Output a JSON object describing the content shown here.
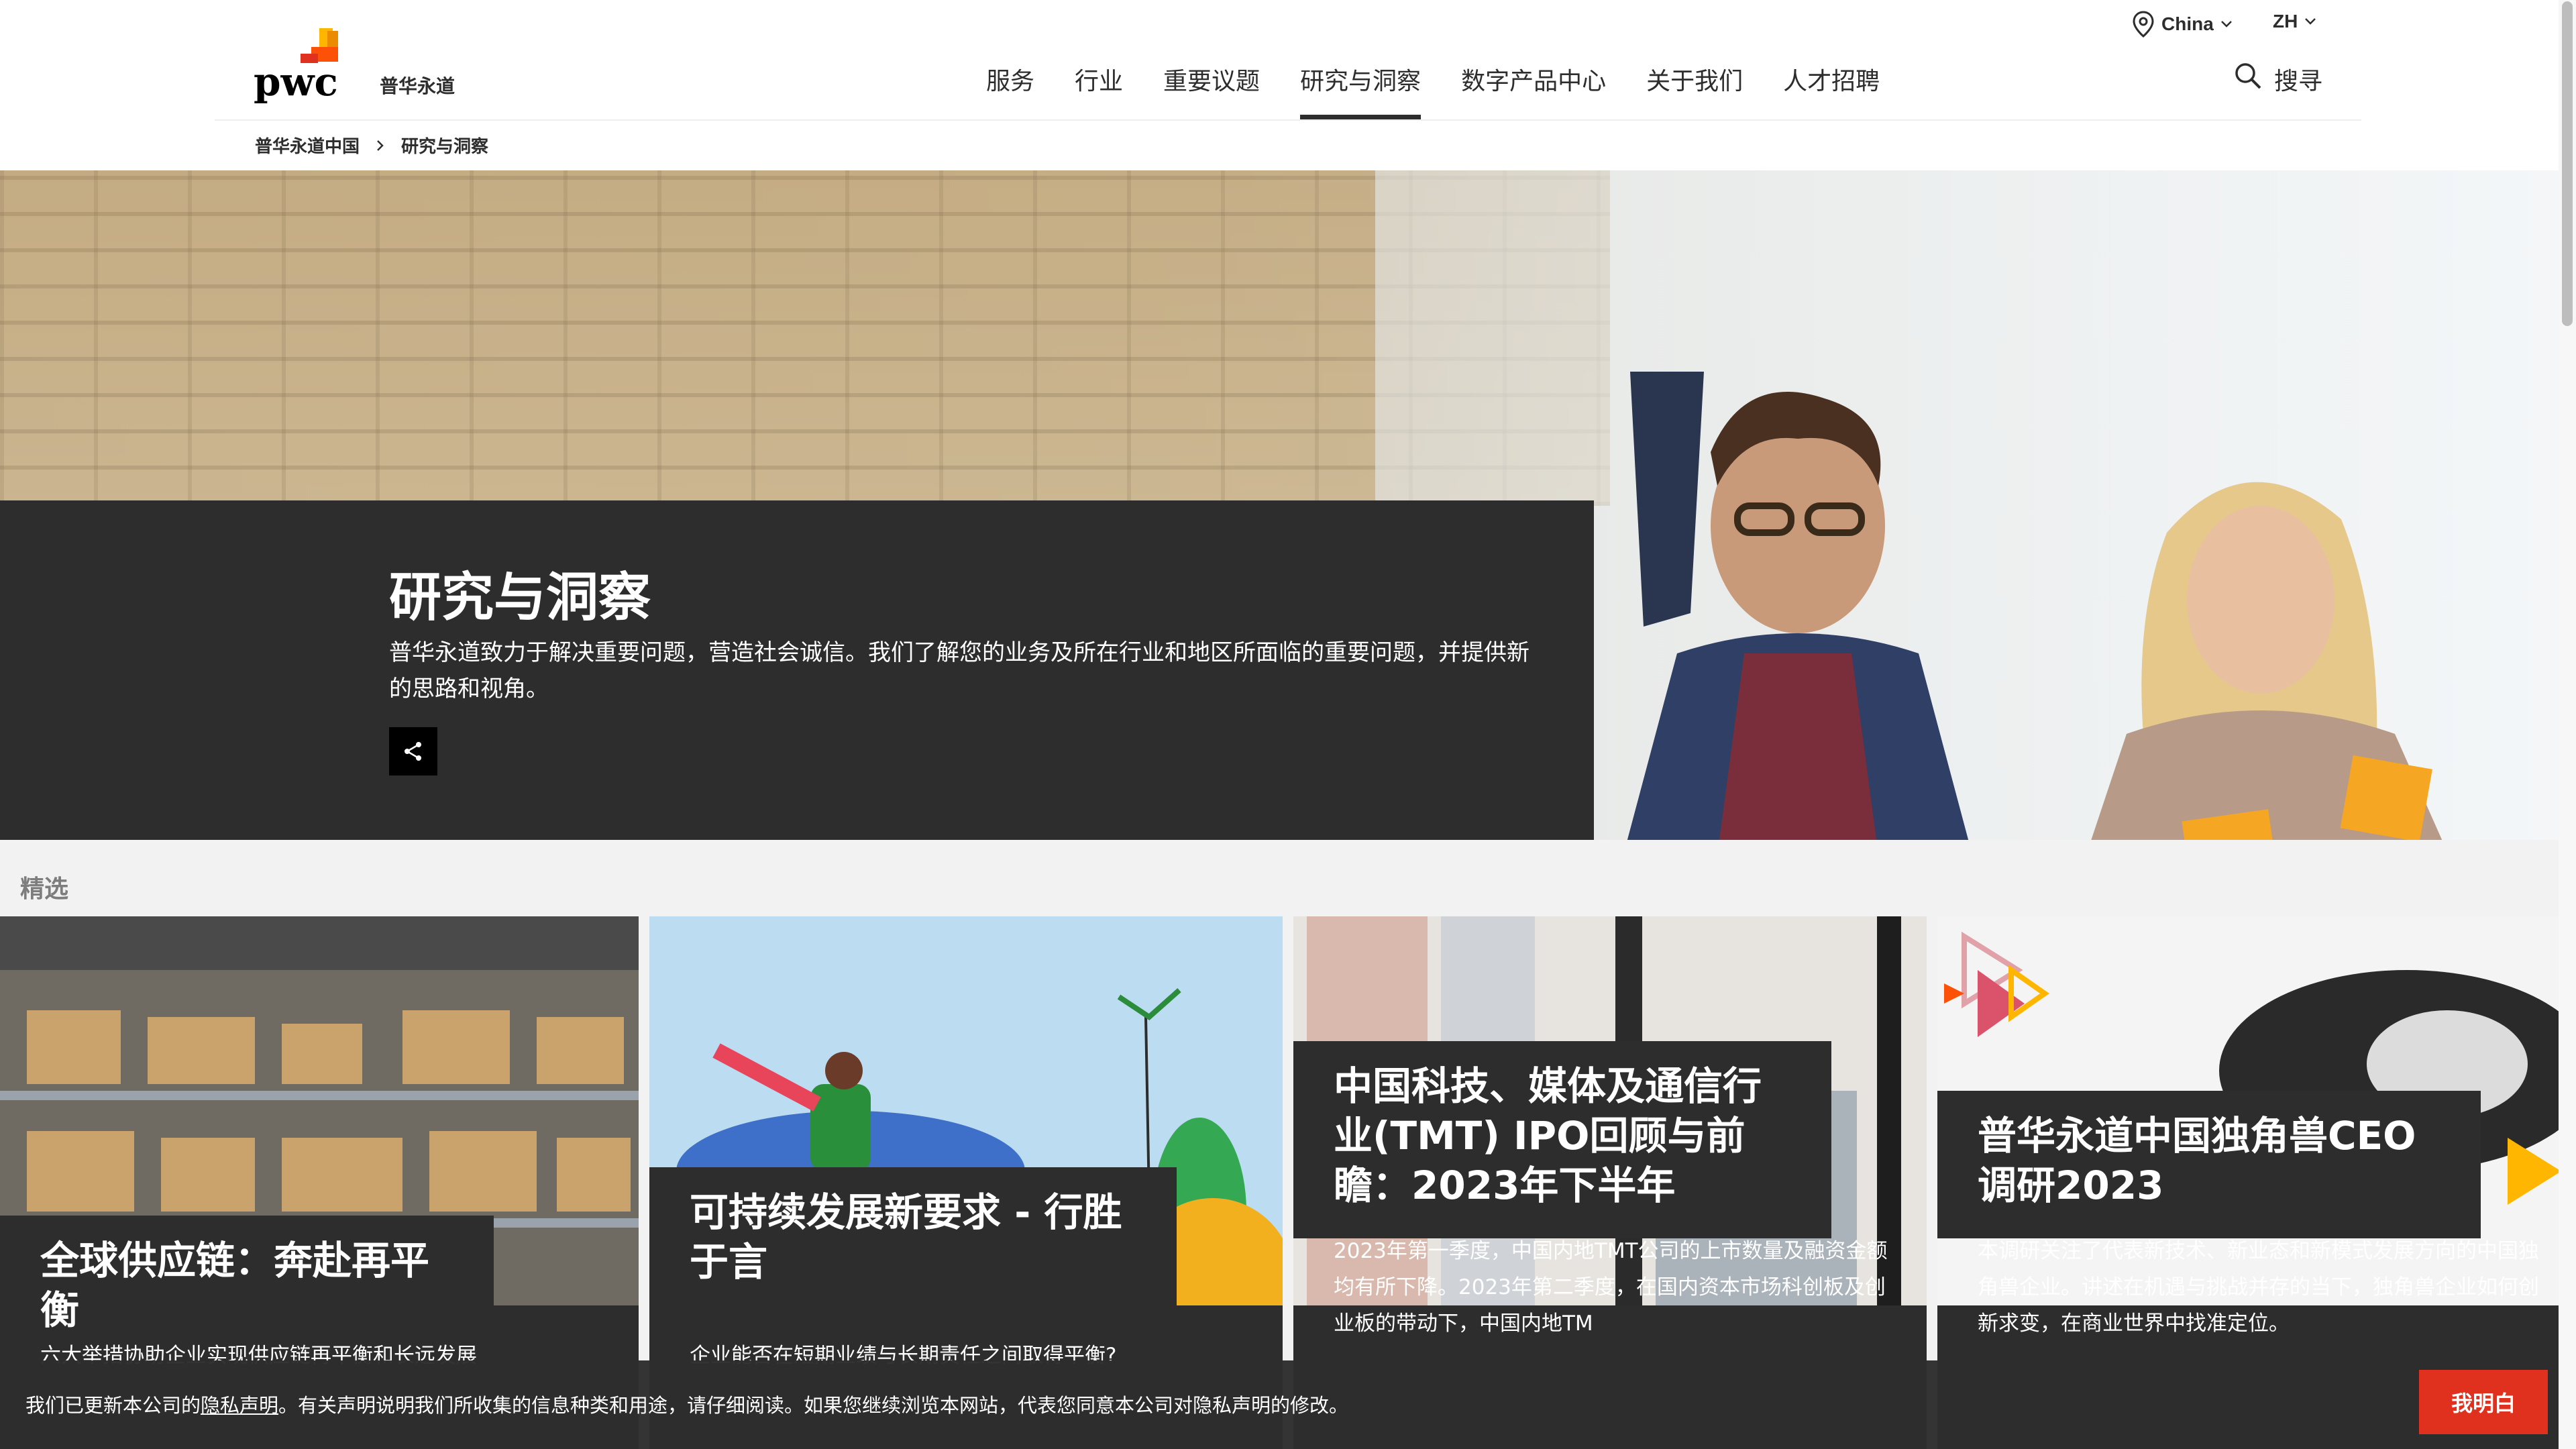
{
  "utility": {
    "region": "China",
    "language": "ZH"
  },
  "brand": {
    "logo_text": "pwc",
    "logo_chinese": "普华永道"
  },
  "nav": {
    "items": [
      {
        "label": "服务"
      },
      {
        "label": "行业"
      },
      {
        "label": "重要议题"
      },
      {
        "label": "研究与洞察",
        "active": true
      },
      {
        "label": "数字产品中心"
      },
      {
        "label": "关于我们"
      },
      {
        "label": "人才招聘"
      }
    ],
    "search_label": "搜寻"
  },
  "breadcrumb": {
    "home": "普华永道中国",
    "current": "研究与洞察"
  },
  "hero": {
    "title": "研究与洞察",
    "description": "普华永道致力于解决重要问题，营造社会诚信。我们了解您的业务及所在行业和地区所面临的重要问题，并提供新的思路和视角。"
  },
  "featured": {
    "label": "精选",
    "cards": [
      {
        "title": "全球供应链：奔赴再平衡",
        "description": "六大举措协助企业实现供应链再平衡和长远发展"
      },
      {
        "title": "可持续发展新要求 - 行胜于言",
        "description": "企业能否在短期业绩与长期责任之间取得平衡?"
      },
      {
        "title": "中国科技、媒体及通信行业(TMT) IPO回顾与前瞻：2023年下半年",
        "description": "2023年第一季度，中国内地TMT公司的上市数量及融资金额均有所下降。2023年第二季度，在国内资本市场科创板及创业板的带动下，中国内地TM"
      },
      {
        "title": "普华永道中国独角兽CEO调研2023",
        "description": "本调研关注了代表新技术、新业态和新模式发展方向的中国独角兽企业。讲述在机遇与挑战并存的当下，独角兽企业如何创新求变，在商业世界中找准定位。"
      }
    ]
  },
  "cookie": {
    "text_before": "我们已更新本公司的",
    "link": "隐私声明",
    "text_after": "。有关声明说明我们所收集的信息种类和用途，请仔细阅读。如果您继续浏览本网站，代表您同意本公司对隐私声明的修改。",
    "button": "我明白"
  },
  "colors": {
    "brand_orange": "#fd5108",
    "brand_red": "#e0301e",
    "dark_panel": "#2d2d2d",
    "text": "#2d2d2d"
  }
}
